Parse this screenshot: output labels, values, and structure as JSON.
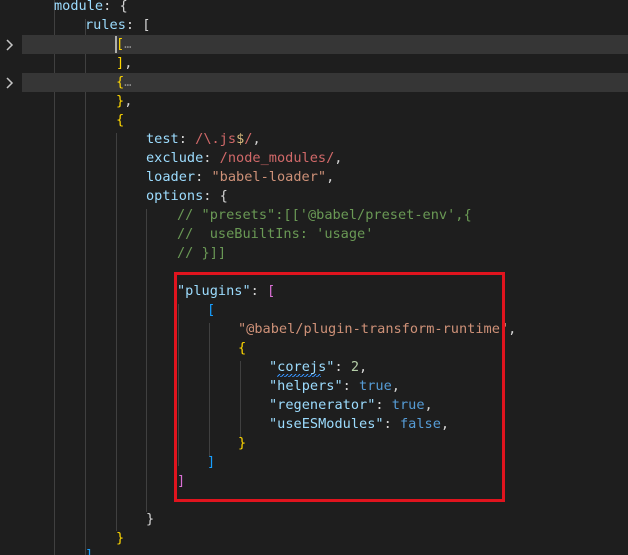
{
  "editor": {
    "lines": {
      "l0": {
        "key": "module",
        "punct": ": {"
      },
      "l1": {
        "key": "rules",
        "punct": ": ["
      },
      "l2": {
        "open": "[",
        "ellipsis": "…"
      },
      "l3": {
        "close": "]",
        "punct": ","
      },
      "l4": {
        "open": "{",
        "ellipsis": "…"
      },
      "l5": {
        "close": "}",
        "punct": ","
      },
      "l6": {
        "open": "{"
      },
      "l7": {
        "key": "test",
        "sep": ": ",
        "re_open": "/",
        "re_body": "\\.js",
        "re_anchor": "$",
        "re_close": "/",
        "punct": ","
      },
      "l8": {
        "key": "exclude",
        "sep": ": ",
        "re": "/node_modules/",
        "punct": ","
      },
      "l9": {
        "key": "loader",
        "sep": ": ",
        "str": "\"babel-loader\"",
        "punct": ","
      },
      "l10": {
        "key": "options",
        "punct": ": {"
      },
      "l11": {
        "comment": "// \"presets\":[['@babel/preset-env',{"
      },
      "l12": {
        "comment": "//  useBuiltIns: 'usage'"
      },
      "l13": {
        "comment": "// }]]"
      },
      "l14": {
        "key": "\"plugins\"",
        "sep": ": ",
        "open": "["
      },
      "l15": {
        "open": "["
      },
      "l16": {
        "str": "\"@babel/plugin-transform-runtime\"",
        "punct": ","
      },
      "l17": {
        "open": "{"
      },
      "l18": {
        "key": "\"corejs\"",
        "sep": ": ",
        "num": "2",
        "punct": ","
      },
      "l19": {
        "key": "\"helpers\"",
        "sep": ": ",
        "bool": "true",
        "punct": ","
      },
      "l20": {
        "key": "\"regenerator\"",
        "sep": ": ",
        "bool": "true",
        "punct": ","
      },
      "l21": {
        "key": "\"useESModules\"",
        "sep": ": ",
        "bool": "false",
        "punct": ","
      },
      "l22": {
        "close": "}"
      },
      "l23": {
        "close": "]"
      },
      "l24": {
        "close": "]"
      },
      "l25": {
        "close": "}"
      },
      "l26": {
        "close": "}"
      },
      "l27": {
        "close": "]"
      }
    },
    "icons": {
      "fold": "chevron-right-icon"
    },
    "colors": {
      "background": "#1e1e1e",
      "highlight_border": "#e0141e",
      "folded_line": "#363636"
    }
  }
}
